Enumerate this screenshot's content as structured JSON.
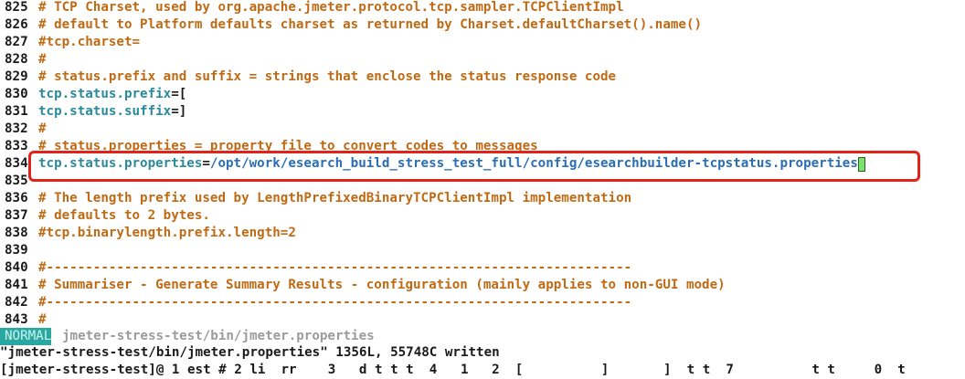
{
  "editor": {
    "lines": [
      {
        "num": "825",
        "segments": [
          {
            "cls": "comment",
            "text": "# TCP Charset, used by org.apache.jmeter.protocol.tcp.sampler.TCPClientImpl"
          }
        ]
      },
      {
        "num": "826",
        "segments": [
          {
            "cls": "comment",
            "text": "# default to Platform defaults charset as returned by Charset.defaultCharset().name()"
          }
        ]
      },
      {
        "num": "827",
        "segments": [
          {
            "cls": "comment",
            "text": "#tcp.charset="
          }
        ]
      },
      {
        "num": "828",
        "segments": [
          {
            "cls": "comment",
            "text": "#"
          }
        ]
      },
      {
        "num": "829",
        "segments": [
          {
            "cls": "comment",
            "text": "# status.prefix and suffix = strings that enclose the status response code"
          }
        ]
      },
      {
        "num": "830",
        "segments": [
          {
            "cls": "key",
            "text": "tcp.status.prefix"
          },
          {
            "cls": "op",
            "text": "=["
          }
        ]
      },
      {
        "num": "831",
        "segments": [
          {
            "cls": "key",
            "text": "tcp.status.suffix"
          },
          {
            "cls": "op",
            "text": "=]"
          }
        ]
      },
      {
        "num": "832",
        "segments": [
          {
            "cls": "comment",
            "text": "#"
          }
        ]
      },
      {
        "num": "833",
        "segments": [
          {
            "cls": "comment",
            "text": "# status.properties = property file to convert codes to messages"
          }
        ]
      },
      {
        "num": "834",
        "segments": [
          {
            "cls": "key",
            "text": "tcp.status.properties"
          },
          {
            "cls": "op",
            "text": "="
          },
          {
            "cls": "val",
            "text": "/opt/work/esearch_build_stress_test_full/config/esearchbuilder-tcpstatus.properties"
          }
        ],
        "cursor": true
      },
      {
        "num": "835",
        "segments": []
      },
      {
        "num": "836",
        "segments": [
          {
            "cls": "comment",
            "text": "# The length prefix used by LengthPrefixedBinaryTCPClientImpl implementation"
          }
        ]
      },
      {
        "num": "837",
        "segments": [
          {
            "cls": "comment",
            "text": "# defaults to 2 bytes."
          }
        ]
      },
      {
        "num": "838",
        "segments": [
          {
            "cls": "comment",
            "text": "#tcp.binarylength.prefix.length=2"
          }
        ]
      },
      {
        "num": "839",
        "segments": []
      },
      {
        "num": "840",
        "segments": [
          {
            "cls": "comment",
            "text": "#---------------------------------------------------------------------------"
          }
        ]
      },
      {
        "num": "841",
        "segments": [
          {
            "cls": "comment",
            "text": "# Summariser - Generate Summary Results - configuration (mainly applies to non-GUI mode)"
          }
        ]
      },
      {
        "num": "842",
        "segments": [
          {
            "cls": "comment",
            "text": "#---------------------------------------------------------------------------"
          }
        ]
      },
      {
        "num": "843",
        "segments": [
          {
            "cls": "comment",
            "text": "#"
          }
        ]
      }
    ]
  },
  "statusline": {
    "mode": "NORMAL",
    "file": "jmeter-stress-test/bin/jmeter.properties"
  },
  "cmdline": {
    "message": "\"jmeter-stress-test/bin/jmeter.properties\" 1356L, 55748C written"
  },
  "partial": {
    "text": "[jmeter-stress-test]@ 1 est # 2 li  rr    3   d t t t  4   1   2  [          ]       ]  t t  7          t t     0  t  "
  },
  "colors": {
    "comment": "#c06a14",
    "key": "#2a8a9a",
    "value": "#2a6db8",
    "highlight": "#e2231a",
    "mode_bg": "#2aa7a0",
    "cursor": "#7ee36e"
  }
}
